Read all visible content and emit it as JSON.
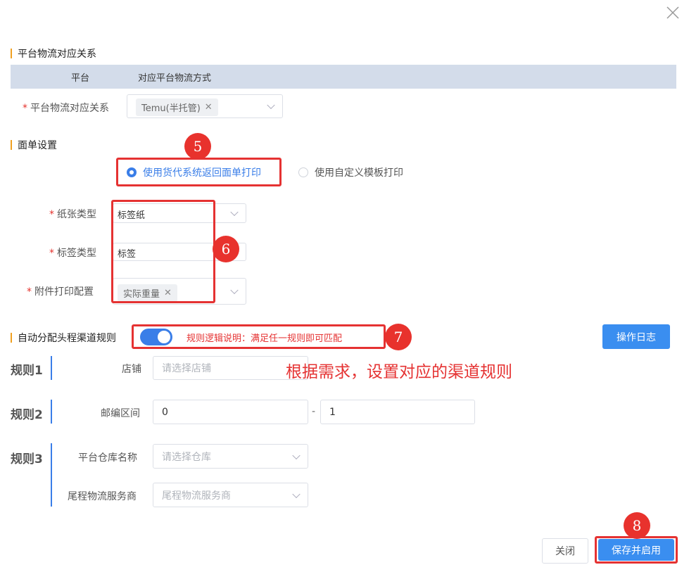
{
  "dialog": {
    "close_icon": "close-icon"
  },
  "platform_section": {
    "title": "平台物流对应关系",
    "table_headers": [
      "平台",
      "对应平台物流方式"
    ],
    "field_label": "平台物流对应关系",
    "selected_tag": "Temu(半托管)"
  },
  "waybill_section": {
    "title": "面单设置",
    "radio_options": [
      {
        "label": "使用货代系统返回面单打印",
        "selected": true
      },
      {
        "label": "使用自定义模板打印",
        "selected": false
      }
    ],
    "paper_type_label": "纸张类型",
    "paper_type_value": "标签纸",
    "label_type_label": "标签类型",
    "label_type_value": "标签",
    "attachment_label": "附件打印配置",
    "attachment_tag": "实际重量"
  },
  "auto_rule_section": {
    "title": "自动分配头程渠道规则",
    "toggle_on": true,
    "logic_note": "规则逻辑说明：满足任一规则即可匹配",
    "log_button": "操作日志",
    "annotation": "根据需求，设置对应的渠道规则"
  },
  "rules": {
    "rule1": {
      "name": "规则1",
      "field_label": "店铺",
      "placeholder": "请选择店铺"
    },
    "rule2": {
      "name": "规则2",
      "field_label": "邮编区间",
      "from": "0",
      "dash": "-",
      "to": "1"
    },
    "rule3": {
      "name": "规则3",
      "warehouse_label": "平台仓库名称",
      "warehouse_placeholder": "请选择仓库",
      "carrier_label": "尾程物流服务商",
      "carrier_placeholder": "尾程物流服务商"
    }
  },
  "footer": {
    "close_label": "关闭",
    "save_label": "保存并启用"
  },
  "step_badges": {
    "b5": "5",
    "b6": "6",
    "b7": "7",
    "b8": "8"
  },
  "colors": {
    "accent": "#3a7ee8",
    "highlight": "#e53232",
    "section_bar": "#f0a020"
  }
}
